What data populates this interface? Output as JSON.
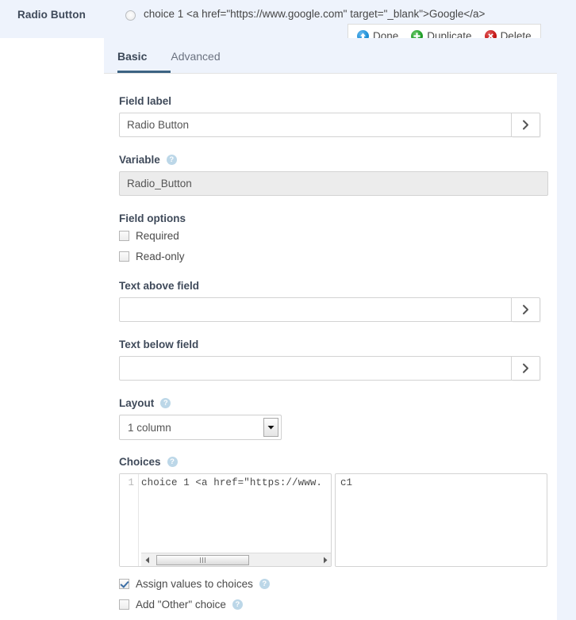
{
  "preview": {
    "field_title": "Radio Button",
    "choice_text": "choice 1 <a href=\"https://www.google.com\" target=\"_blank\">Google</a>",
    "radio_icon": "radio-unselected-icon"
  },
  "actions": [
    {
      "label": "Done",
      "icon": "circle-up-arrow-icon",
      "color": "#1d8fd6"
    },
    {
      "label": "Duplicate",
      "icon": "circle-plus-icon",
      "color": "#1f9e28"
    },
    {
      "label": "Delete",
      "icon": "circle-x-icon",
      "color": "#c41414"
    }
  ],
  "tabs": [
    {
      "label": "Basic",
      "active": true
    },
    {
      "label": "Advanced",
      "active": false
    }
  ],
  "form": {
    "field_label": {
      "label": "Field label",
      "value": "Radio Button",
      "placeholder": "",
      "expand_icon": "chevron-right-icon"
    },
    "variable": {
      "label": "Variable",
      "value": "Radio_Button",
      "help_icon": "help-circle-icon"
    },
    "field_options": {
      "label": "Field options",
      "items": [
        {
          "label": "Required",
          "checked": false
        },
        {
          "label": "Read-only",
          "checked": false
        }
      ]
    },
    "text_above": {
      "label": "Text above field",
      "value": "",
      "placeholder": "",
      "expand_icon": "chevron-right-icon"
    },
    "text_below": {
      "label": "Text below field",
      "value": "",
      "placeholder": "",
      "expand_icon": "chevron-right-icon"
    },
    "layout": {
      "label": "Layout",
      "selected": "1 column",
      "help_icon": "help-circle-icon",
      "dropdown_icon": "caret-down-icon"
    },
    "choices": {
      "label": "Choices",
      "help_icon": "help-circle-icon",
      "line_number": "1",
      "choices_text": "choice 1 <a href=\"https://www.",
      "values_text": "c1",
      "scroll_left_icon": "caret-left-icon",
      "scroll_right_icon": "caret-right-icon"
    },
    "bottom_options": [
      {
        "label": "Assign values to choices",
        "checked": true,
        "help_icon": "help-circle-icon"
      },
      {
        "label": "Add \"Other\" choice",
        "checked": false,
        "help_icon": "help-circle-icon"
      }
    ]
  }
}
